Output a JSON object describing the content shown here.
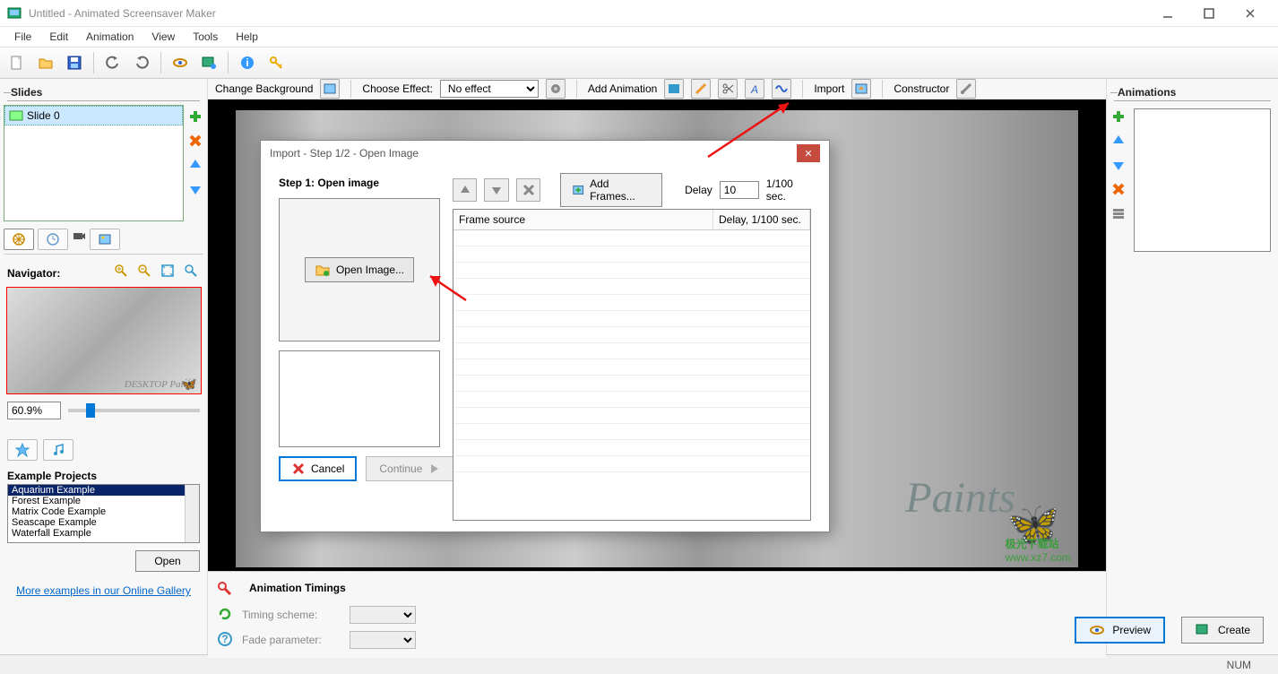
{
  "window": {
    "title": "Untitled - Animated Screensaver Maker"
  },
  "menu": {
    "file": "File",
    "edit": "Edit",
    "animation": "Animation",
    "view": "View",
    "tools": "Tools",
    "help": "Help"
  },
  "slides": {
    "heading": "Slides",
    "item0": "Slide 0"
  },
  "navigator": {
    "label": "Navigator:",
    "watermark": "DESKTOP Paints",
    "zoom": "60.9%"
  },
  "examples": {
    "heading": "Example Projects",
    "items": [
      "Aquarium Example",
      "Forest Example",
      "Matrix Code Example",
      "Seascape Example",
      "Waterfall Example"
    ],
    "open": "Open",
    "gallery": "More examples in our Online Gallery"
  },
  "actionbar": {
    "change_bg": "Change Background",
    "choose_effect": "Choose Effect:",
    "effect_value": "No effect",
    "add_animation": "Add Animation",
    "import": "Import",
    "constructor": "Constructor"
  },
  "canvas": {
    "paints": "Paints",
    "butterfly": "🦋",
    "wm_top": "极光下载站",
    "wm_link": "www.xz7.com"
  },
  "timing": {
    "heading": "Animation Timings",
    "scheme": "Timing scheme:",
    "fade": "Fade parameter:"
  },
  "buttons": {
    "preview": "Preview",
    "create": "Create"
  },
  "right": {
    "heading": "Animations"
  },
  "status": {
    "num": "NUM"
  },
  "modal": {
    "title": "Import - Step 1/2 - Open Image",
    "step": "Step 1: Open image",
    "open_image": "Open Image...",
    "cancel": "Cancel",
    "continue": "Continue",
    "add_frames": "Add Frames...",
    "delay_label": "Delay",
    "delay_value": "10",
    "delay_unit": "1/100 sec.",
    "col_source": "Frame source",
    "col_delay": "Delay, 1/100 sec."
  }
}
